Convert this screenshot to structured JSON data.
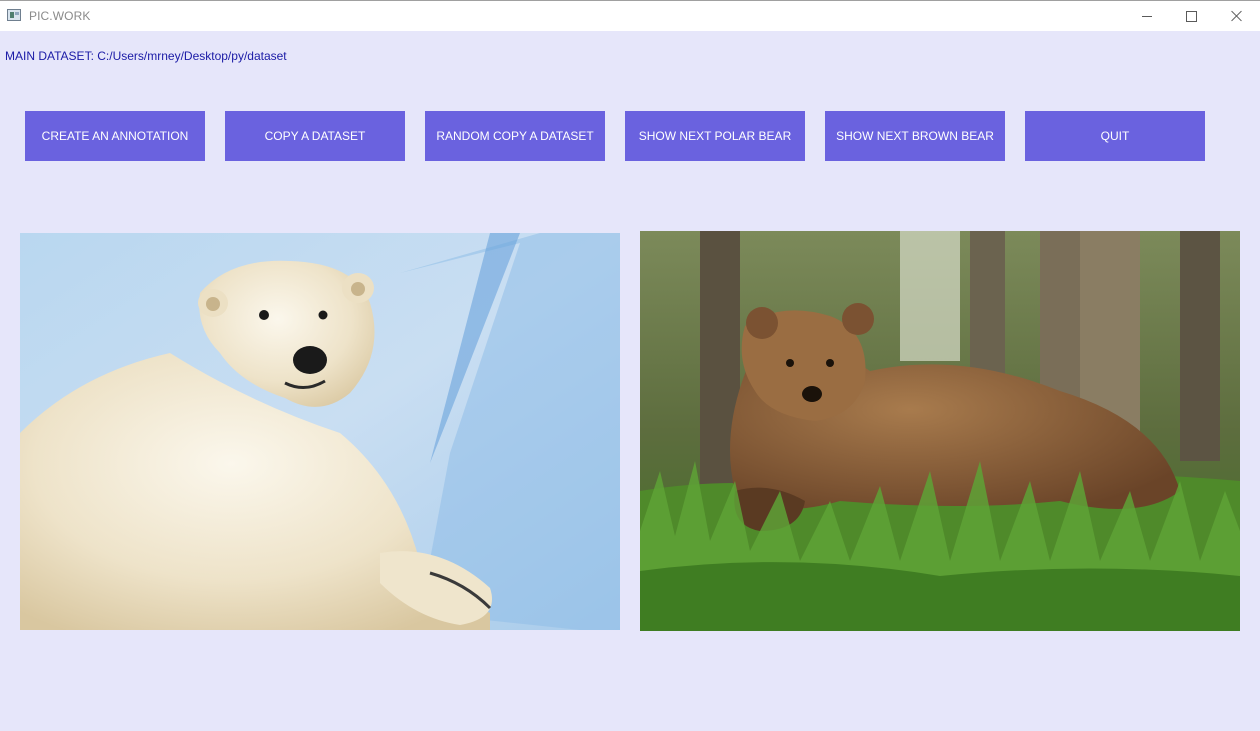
{
  "window": {
    "title": "PIC.WORK",
    "controls": {
      "minimize": "minimize-icon",
      "maximize": "maximize-icon",
      "close": "close-icon"
    }
  },
  "dataset": {
    "label": "MAIN DATASET: C:/Users/mrney/Desktop/py/dataset"
  },
  "toolbar": {
    "create_annotation": "CREATE AN ANNOTATION",
    "copy_dataset": "COPY A DATASET",
    "random_copy_dataset": "RANDOM COPY A DATASET",
    "show_next_polar_bear": "SHOW NEXT POLAR BEAR",
    "show_next_brown_bear": "SHOW NEXT BROWN BEAR",
    "quit": "QUIT"
  },
  "images": {
    "left": "polar-bear-photo",
    "right": "brown-bear-photo"
  },
  "colors": {
    "background": "#e6e6fa",
    "button": "#6a62df",
    "button_text": "#ffffff",
    "label_text": "#1a1aa6"
  }
}
